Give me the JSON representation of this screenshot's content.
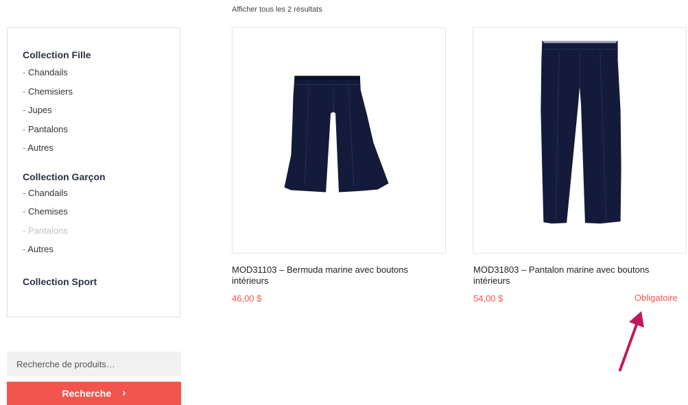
{
  "results": {
    "count_text": "Afficher tous les 2 résultats"
  },
  "sidebar": {
    "collections": [
      {
        "title": "Collection Fille",
        "items": [
          {
            "label": "Chandails"
          },
          {
            "label": "Chemisiers"
          },
          {
            "label": "Jupes"
          },
          {
            "label": "Pantalons"
          },
          {
            "label": "Autres"
          }
        ]
      },
      {
        "title": "Collection Garçon",
        "items": [
          {
            "label": "Chandails"
          },
          {
            "label": "Chemises"
          },
          {
            "label": "Pantalons",
            "state": "inactive"
          },
          {
            "label": "Autres"
          }
        ]
      },
      {
        "title": "Collection Sport",
        "items": []
      }
    ],
    "item_prefix": "-"
  },
  "search": {
    "placeholder": "Recherche de produits…",
    "button_label": "Recherche",
    "button_icon": "chevron-right-icon"
  },
  "products": [
    {
      "name_line1": "MOD31103 – Bermuda marine avec boutons",
      "name_line2": "intérieurs",
      "price": "46,00 $",
      "image": "navy-bermuda-shorts"
    },
    {
      "name_line1": "MOD31803 – Pantalon marine avec boutons",
      "name_line2": "intérieurs",
      "price": "54,00 $",
      "badge": "Obligatoire",
      "image": "navy-trousers"
    }
  ],
  "colors": {
    "accent": "#f2554d",
    "heading": "#2a3140",
    "product_navy": "#141a3a",
    "annotation_arrow": "#c2185b"
  }
}
